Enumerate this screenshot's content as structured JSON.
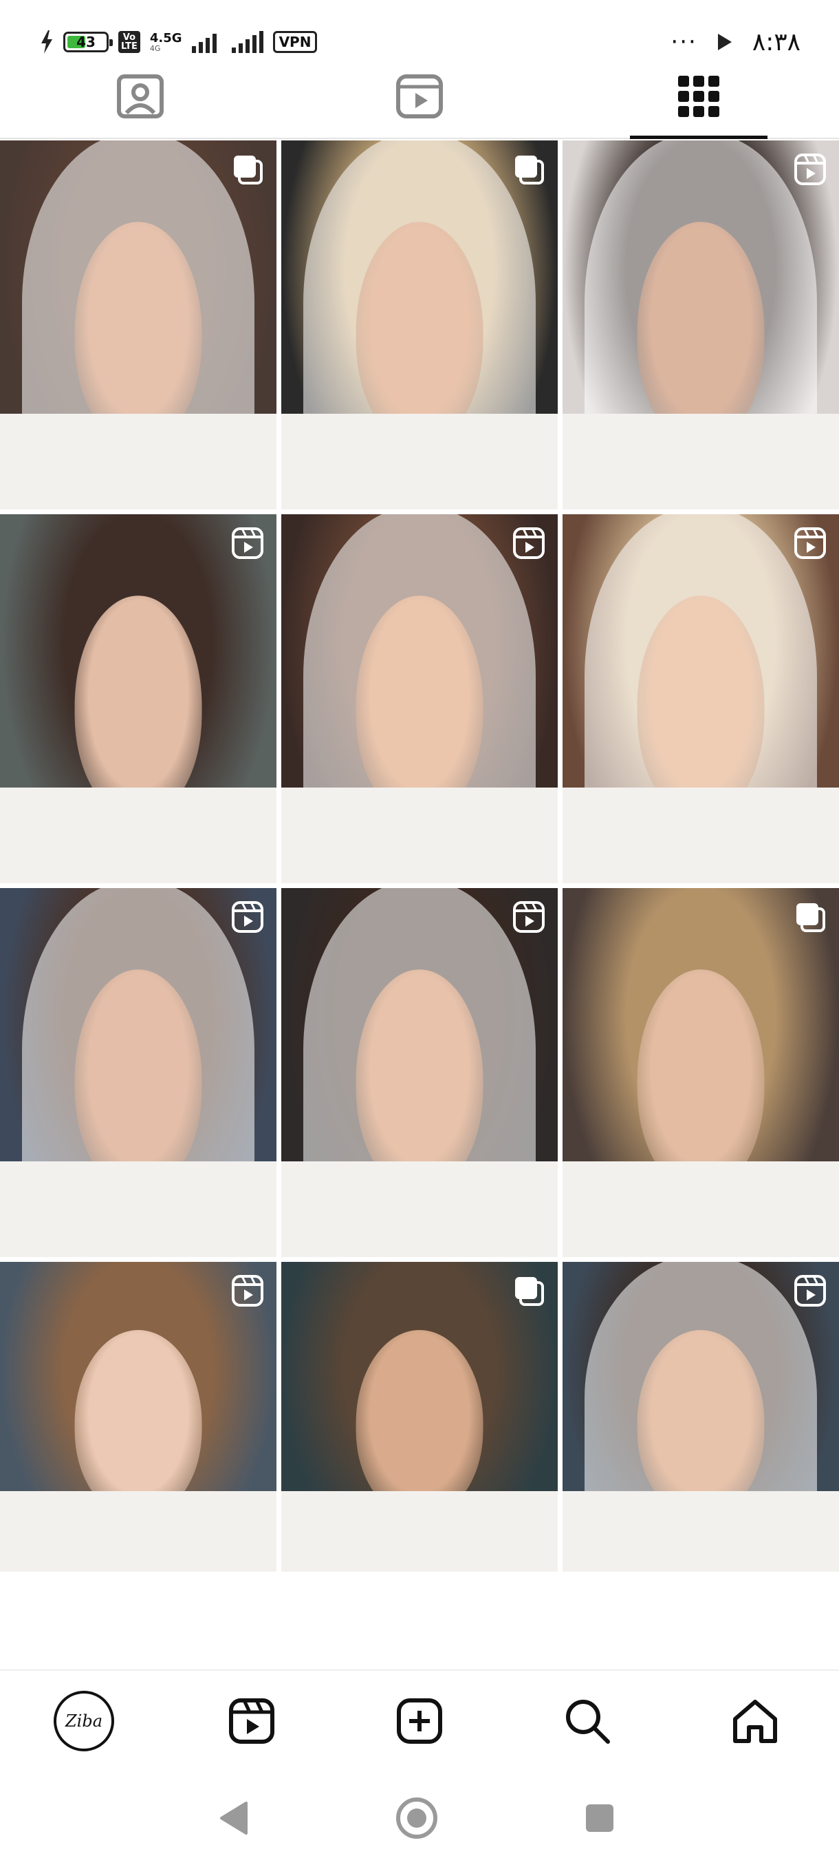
{
  "status_bar": {
    "battery_level": "43",
    "volte": "Vo\nLTE",
    "network_type": "4.5G",
    "network_sub": "4G",
    "vpn_label": "VPN",
    "more": "···",
    "time": "۸:۳۸"
  },
  "tabs": [
    {
      "name": "tagged",
      "icon": "person-tag-icon"
    },
    {
      "name": "reels",
      "icon": "reels-icon"
    },
    {
      "name": "posts",
      "icon": "grid-icon",
      "active": true
    }
  ],
  "grid": {
    "tiles": [
      {
        "badge": "carousel-icon",
        "bg": "#4a3a34",
        "skin": "#e6c2ad",
        "hair": "#5a4034",
        "veil": true
      },
      {
        "badge": "carousel-icon",
        "bg": "#2a2a2a",
        "skin": "#e9c3ab",
        "hair": "#c9a978",
        "veil": true
      },
      {
        "badge": "reels-icon",
        "bg": "#d9d4d2",
        "skin": "#dcb59f",
        "hair": "#2a1f1b",
        "veil": true
      },
      {
        "badge": "reels-icon",
        "bg": "#5a6260",
        "skin": "#e3bda6",
        "hair": "#3f2e28",
        "veil": false
      },
      {
        "badge": "reels-icon",
        "bg": "#3a2a26",
        "skin": "#ebc5ac",
        "hair": "#6a4634",
        "veil": true
      },
      {
        "badge": "reels-icon",
        "bg": "#6b4a3a",
        "skin": "#efcdb5",
        "hair": "#d1b690",
        "veil": true
      },
      {
        "badge": "reels-icon",
        "bg": "#3e4a5c",
        "skin": "#e4bea8",
        "hair": "#4a3024",
        "veil": true
      },
      {
        "badge": "reels-icon",
        "bg": "#2e2a2a",
        "skin": "#e8c2aa",
        "hair": "#3a2820",
        "veil": true
      },
      {
        "badge": "carousel-icon",
        "bg": "#4c3f3a",
        "skin": "#e3bca2",
        "hair": "#b39268",
        "veil": false
      },
      {
        "badge": "reels-icon",
        "bg": "#4a5866",
        "skin": "#ebc9b4",
        "hair": "#8a6446",
        "veil": false
      },
      {
        "badge": "carousel-icon",
        "bg": "#2e3f44",
        "skin": "#d9ab8c",
        "hair": "#5a4636",
        "veil": false
      },
      {
        "badge": "reels-icon",
        "bg": "#3c4a58",
        "skin": "#e8c3ab",
        "hair": "#3a2a22",
        "veil": true
      }
    ]
  },
  "bottom_nav": {
    "profile_avatar_text": "Ziba",
    "items": [
      "profile",
      "reels",
      "create",
      "search",
      "home"
    ]
  },
  "colors": {
    "accent": "#111111",
    "battery_fill": "#3db83d"
  }
}
